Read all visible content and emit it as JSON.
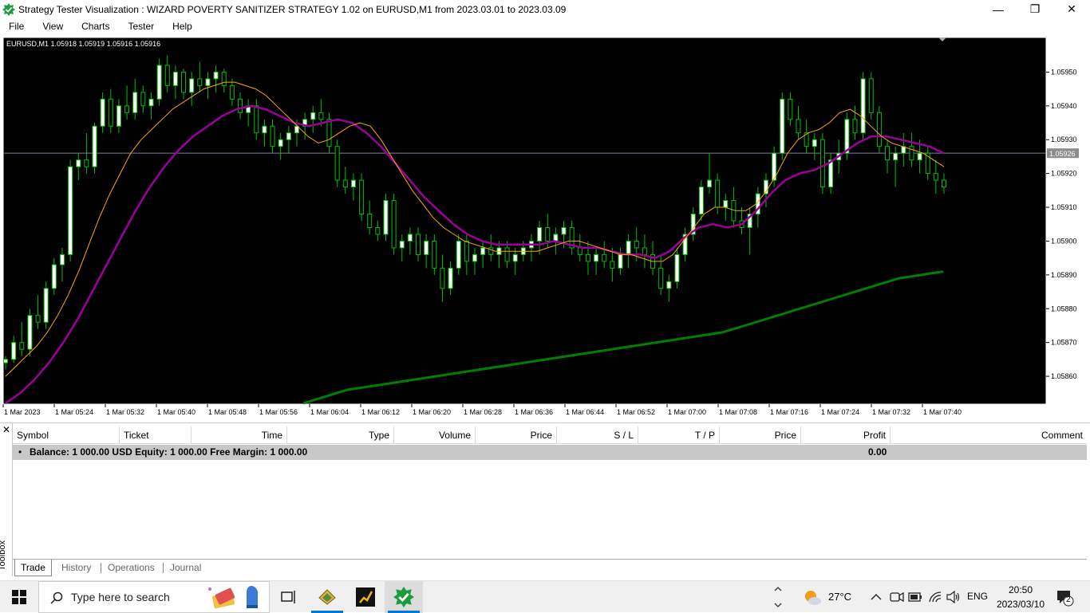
{
  "window": {
    "title": "Strategy Tester Visualization : WIZARD POVERTY SANITIZER STRATEGY 1.02 on EURUSD,M1 from 2023.03.01 to 2023.03.09",
    "minimize": "—",
    "maximize": "❐",
    "close": "✕"
  },
  "menu": [
    "File",
    "View",
    "Charts",
    "Tester",
    "Help"
  ],
  "chart": {
    "info": "EURUSD,M1  1.05918 1.05919 1.05916 1.05916",
    "current_price_label": "1.05926",
    "price_labels": [
      "1.05950",
      "1.05940",
      "1.05930",
      "1.05920",
      "1.05910",
      "1.05900",
      "1.05890",
      "1.05880",
      "1.05870",
      "1.05860"
    ],
    "time_labels": [
      "1 Mar 2023",
      "1 Mar 05:24",
      "1 Mar 05:32",
      "1 Mar 05:40",
      "1 Mar 05:48",
      "1 Mar 05:56",
      "1 Mar 06:04",
      "1 Mar 06:12",
      "1 Mar 06:20",
      "1 Mar 06:28",
      "1 Mar 06:36",
      "1 Mar 06:44",
      "1 Mar 06:52",
      "1 Mar 07:00",
      "1 Mar 07:08",
      "1 Mar 07:16",
      "1 Mar 07:24",
      "1 Mar 07:32",
      "1 Mar 07:40"
    ],
    "colors": {
      "background": "#000000",
      "bull_candle": "#ffffff",
      "bear_candle": "#ffffff",
      "wick": "#00c000",
      "ma_fast": "#ffa500",
      "ma_medium": "#9b009b",
      "ma_slow": "#008000",
      "price_line": "#8080a0"
    }
  },
  "chart_data": {
    "type": "candlestick",
    "symbol": "EURUSD",
    "timeframe": "M1",
    "y_range": [
      1.05852,
      1.0596
    ],
    "current_price": 1.05926,
    "ohlc": [
      [
        1.05864,
        1.05866,
        1.05862,
        1.05865
      ],
      [
        1.05865,
        1.05872,
        1.05864,
        1.0587
      ],
      [
        1.0587,
        1.05876,
        1.05866,
        1.05868
      ],
      [
        1.05868,
        1.0588,
        1.05866,
        1.05878
      ],
      [
        1.05878,
        1.05884,
        1.05874,
        1.05876
      ],
      [
        1.05876,
        1.05888,
        1.05874,
        1.05886
      ],
      [
        1.05886,
        1.05895,
        1.05884,
        1.05893
      ],
      [
        1.05893,
        1.05898,
        1.05888,
        1.05896
      ],
      [
        1.05896,
        1.05924,
        1.05894,
        1.05922
      ],
      [
        1.05922,
        1.05926,
        1.05918,
        1.05924
      ],
      [
        1.05924,
        1.05932,
        1.0592,
        1.05922
      ],
      [
        1.05922,
        1.05935,
        1.0592,
        1.05934
      ],
      [
        1.05934,
        1.05944,
        1.05932,
        1.05942
      ],
      [
        1.05942,
        1.05945,
        1.05932,
        1.05934
      ],
      [
        1.05934,
        1.05942,
        1.05932,
        1.0594
      ],
      [
        1.0594,
        1.05946,
        1.05936,
        1.05938
      ],
      [
        1.05938,
        1.05948,
        1.05936,
        1.05944
      ],
      [
        1.05944,
        1.05946,
        1.05938,
        1.0594
      ],
      [
        1.0594,
        1.05944,
        1.05936,
        1.05942
      ],
      [
        1.05942,
        1.05954,
        1.0594,
        1.05952
      ],
      [
        1.05952,
        1.05955,
        1.05944,
        1.05946
      ],
      [
        1.05946,
        1.05952,
        1.05942,
        1.0595
      ],
      [
        1.0595,
        1.05951,
        1.05942,
        1.05944
      ],
      [
        1.05944,
        1.0595,
        1.0594,
        1.05948
      ],
      [
        1.05948,
        1.05953,
        1.05944,
        1.05946
      ],
      [
        1.05946,
        1.0595,
        1.05942,
        1.05948
      ],
      [
        1.05948,
        1.05952,
        1.05944,
        1.0595
      ],
      [
        1.0595,
        1.05951,
        1.05944,
        1.05946
      ],
      [
        1.05946,
        1.05948,
        1.0594,
        1.05942
      ],
      [
        1.05942,
        1.05944,
        1.05936,
        1.05938
      ],
      [
        1.05938,
        1.05942,
        1.05934,
        1.0594
      ],
      [
        1.0594,
        1.05942,
        1.0593,
        1.05932
      ],
      [
        1.05932,
        1.05936,
        1.05928,
        1.05934
      ],
      [
        1.05934,
        1.05936,
        1.05926,
        1.05928
      ],
      [
        1.05928,
        1.05932,
        1.05924,
        1.0593
      ],
      [
        1.0593,
        1.05934,
        1.05926,
        1.05932
      ],
      [
        1.05932,
        1.05936,
        1.05928,
        1.05934
      ],
      [
        1.05934,
        1.05938,
        1.0593,
        1.05936
      ],
      [
        1.05936,
        1.0594,
        1.05932,
        1.05938
      ],
      [
        1.05938,
        1.05942,
        1.05934,
        1.05936
      ],
      [
        1.05936,
        1.05938,
        1.05926,
        1.05928
      ],
      [
        1.05928,
        1.0593,
        1.05916,
        1.05918
      ],
      [
        1.05918,
        1.05922,
        1.05914,
        1.05916
      ],
      [
        1.05916,
        1.0592,
        1.05912,
        1.05918
      ],
      [
        1.05918,
        1.0592,
        1.05906,
        1.05908
      ],
      [
        1.05908,
        1.05912,
        1.05902,
        1.05904
      ],
      [
        1.05904,
        1.05906,
        1.059,
        1.05902
      ],
      [
        1.05902,
        1.05914,
        1.059,
        1.05912
      ],
      [
        1.05912,
        1.05914,
        1.05896,
        1.05898
      ],
      [
        1.05898,
        1.05902,
        1.05894,
        1.059
      ],
      [
        1.059,
        1.05904,
        1.05896,
        1.05902
      ],
      [
        1.05902,
        1.05904,
        1.05894,
        1.05896
      ],
      [
        1.05896,
        1.05902,
        1.05892,
        1.059
      ],
      [
        1.059,
        1.05902,
        1.0589,
        1.05892
      ],
      [
        1.05892,
        1.05896,
        1.05882,
        1.05886
      ],
      [
        1.05886,
        1.05894,
        1.05884,
        1.05892
      ],
      [
        1.05892,
        1.05902,
        1.0589,
        1.059
      ],
      [
        1.059,
        1.05902,
        1.0589,
        1.05894
      ],
      [
        1.05894,
        1.05898,
        1.0589,
        1.05896
      ],
      [
        1.05896,
        1.059,
        1.05892,
        1.05898
      ],
      [
        1.05898,
        1.05902,
        1.05894,
        1.05896
      ],
      [
        1.05896,
        1.059,
        1.05892,
        1.05898
      ],
      [
        1.05898,
        1.059,
        1.05892,
        1.05894
      ],
      [
        1.05894,
        1.05898,
        1.0589,
        1.05896
      ],
      [
        1.05896,
        1.059,
        1.05894,
        1.05898
      ],
      [
        1.05898,
        1.05902,
        1.05894,
        1.059
      ],
      [
        1.059,
        1.05906,
        1.05896,
        1.05904
      ],
      [
        1.05904,
        1.05908,
        1.05898,
        1.059
      ],
      [
        1.059,
        1.05904,
        1.05896,
        1.05902
      ],
      [
        1.05902,
        1.05906,
        1.05898,
        1.05904
      ],
      [
        1.05904,
        1.05906,
        1.05896,
        1.05898
      ],
      [
        1.05898,
        1.05902,
        1.05894,
        1.05896
      ],
      [
        1.05896,
        1.059,
        1.0589,
        1.05894
      ],
      [
        1.05894,
        1.05898,
        1.0589,
        1.05896
      ],
      [
        1.05896,
        1.059,
        1.05892,
        1.05894
      ],
      [
        1.05894,
        1.05898,
        1.05888,
        1.05892
      ],
      [
        1.05892,
        1.05898,
        1.0589,
        1.05896
      ],
      [
        1.05896,
        1.05902,
        1.05892,
        1.059
      ],
      [
        1.059,
        1.05904,
        1.05894,
        1.05898
      ],
      [
        1.05898,
        1.05902,
        1.05892,
        1.05896
      ],
      [
        1.05896,
        1.059,
        1.0589,
        1.05892
      ],
      [
        1.05892,
        1.05896,
        1.05884,
        1.05886
      ],
      [
        1.05886,
        1.0589,
        1.05882,
        1.05888
      ],
      [
        1.05888,
        1.05898,
        1.05886,
        1.05896
      ],
      [
        1.05896,
        1.05904,
        1.05894,
        1.05902
      ],
      [
        1.05902,
        1.0591,
        1.059,
        1.05908
      ],
      [
        1.05908,
        1.05918,
        1.05906,
        1.05916
      ],
      [
        1.05916,
        1.05926,
        1.05914,
        1.05918
      ],
      [
        1.05918,
        1.0592,
        1.05908,
        1.0591
      ],
      [
        1.0591,
        1.05914,
        1.05906,
        1.05912
      ],
      [
        1.05912,
        1.05916,
        1.05904,
        1.05906
      ],
      [
        1.05906,
        1.0591,
        1.05902,
        1.05904
      ],
      [
        1.05904,
        1.0591,
        1.05896,
        1.05908
      ],
      [
        1.05908,
        1.05916,
        1.05904,
        1.05914
      ],
      [
        1.05914,
        1.0592,
        1.0591,
        1.05918
      ],
      [
        1.05918,
        1.05928,
        1.05916,
        1.05926
      ],
      [
        1.05926,
        1.05944,
        1.05924,
        1.05942
      ],
      [
        1.05942,
        1.05944,
        1.05934,
        1.05936
      ],
      [
        1.05936,
        1.0594,
        1.0593,
        1.05932
      ],
      [
        1.05932,
        1.05936,
        1.05926,
        1.05928
      ],
      [
        1.05928,
        1.05932,
        1.05924,
        1.0593
      ],
      [
        1.0593,
        1.05932,
        1.05914,
        1.05916
      ],
      [
        1.05916,
        1.05926,
        1.05914,
        1.05924
      ],
      [
        1.05924,
        1.0593,
        1.0592,
        1.05926
      ],
      [
        1.05926,
        1.05938,
        1.05924,
        1.05936
      ],
      [
        1.05936,
        1.0594,
        1.0593,
        1.05932
      ],
      [
        1.05932,
        1.0595,
        1.0593,
        1.05948
      ],
      [
        1.05948,
        1.0595,
        1.05936,
        1.05938
      ],
      [
        1.05938,
        1.0594,
        1.05926,
        1.05928
      ],
      [
        1.05928,
        1.0593,
        1.0592,
        1.05924
      ],
      [
        1.05924,
        1.05928,
        1.05916,
        1.05926
      ],
      [
        1.05926,
        1.05932,
        1.05922,
        1.05928
      ],
      [
        1.05928,
        1.05932,
        1.05922,
        1.05924
      ],
      [
        1.05924,
        1.0593,
        1.0592,
        1.05926
      ],
      [
        1.05926,
        1.05928,
        1.05918,
        1.0592
      ],
      [
        1.0592,
        1.05924,
        1.05914,
        1.05918
      ],
      [
        1.05918,
        1.0592,
        1.05914,
        1.05916
      ]
    ],
    "ma_fast": [
      1.0586,
      1.05863,
      1.05866,
      1.05869,
      1.05873,
      1.05878,
      1.05884,
      1.05891,
      1.05899,
      1.05907,
      1.05914,
      1.0592,
      1.05926,
      1.0593,
      1.05933,
      1.05936,
      1.05939,
      1.05941,
      1.05943,
      1.05945,
      1.05946,
      1.05947,
      1.05947,
      1.05946,
      1.05945,
      1.05943,
      1.0594,
      1.05937,
      1.05934,
      1.05931,
      1.05929,
      1.0593,
      1.05932,
      1.05934,
      1.05935,
      1.05934,
      1.0593,
      1.05925,
      1.0592,
      1.05915,
      1.05911,
      1.05907,
      1.05904,
      1.05902,
      1.059,
      1.05899,
      1.05898,
      1.05897,
      1.05897,
      1.05897,
      1.05897,
      1.05897,
      1.05898,
      1.05899,
      1.059,
      1.059,
      1.05899,
      1.05898,
      1.05897,
      1.05896,
      1.05896,
      1.05895,
      1.05894,
      1.05894,
      1.05896,
      1.059,
      1.05904,
      1.05908,
      1.0591,
      1.0591,
      1.05909,
      1.05909,
      1.05911,
      1.05915,
      1.0592,
      1.05926,
      1.0593,
      1.05932,
      1.05933,
      1.05935,
      1.05938,
      1.05939,
      1.05937,
      1.05934,
      1.05931,
      1.05929,
      1.05928,
      1.05927,
      1.05926,
      1.05924,
      1.05922
    ],
    "ma_medium": [
      1.05852,
      1.05855,
      1.05859,
      1.05864,
      1.0587,
      1.05877,
      1.05885,
      1.05893,
      1.05901,
      1.05909,
      1.05916,
      1.05922,
      1.05927,
      1.05931,
      1.05934,
      1.05937,
      1.05939,
      1.0594,
      1.05939,
      1.05937,
      1.05935,
      1.05934,
      1.05935,
      1.05936,
      1.05935,
      1.05932,
      1.05928,
      1.05923,
      1.05918,
      1.05913,
      1.05909,
      1.05905,
      1.05902,
      1.059,
      1.05899,
      1.05899,
      1.05899,
      1.05899,
      1.059,
      1.05899,
      1.05898,
      1.05898,
      1.05897,
      1.05896,
      1.05896,
      1.05895,
      1.05897,
      1.05901,
      1.05904,
      1.05905,
      1.05904,
      1.05905,
      1.05909,
      1.05914,
      1.05918,
      1.0592,
      1.05921,
      1.05923,
      1.05926,
      1.05929,
      1.05931,
      1.05931,
      1.0593,
      1.05929,
      1.05928,
      1.05926
    ],
    "ma_slow": [
      1.05852,
      1.05854,
      1.05856,
      1.05857,
      1.05858,
      1.05859,
      1.0586,
      1.05861,
      1.05862,
      1.05863,
      1.05864,
      1.05865,
      1.05866,
      1.05867,
      1.05868,
      1.05869,
      1.0587,
      1.05871,
      1.05872,
      1.05873,
      1.05875,
      1.05877,
      1.05879,
      1.05881,
      1.05883,
      1.05885,
      1.05887,
      1.05889,
      1.0589,
      1.05891
    ]
  },
  "toolbox": {
    "close": "✕",
    "label": "Toolbox",
    "columns": [
      "Symbol",
      "Ticket",
      "Time",
      "Type",
      "Volume",
      "Price",
      "S / L",
      "T / P",
      "Price",
      "Profit",
      "Comment"
    ],
    "balance_bullet": "•",
    "balance_text": "Balance: 1 000.00 USD  Equity: 1 000.00  Free Margin: 1 000.00",
    "profit": "0.00",
    "tabs": [
      "Trade",
      "History",
      "Operations",
      "Journal"
    ]
  },
  "taskbar": {
    "search_placeholder": "Type here to search",
    "weather": "27°C",
    "language": "ENG",
    "time": "20:50",
    "date": "2023/03/10",
    "notifications": "2"
  }
}
